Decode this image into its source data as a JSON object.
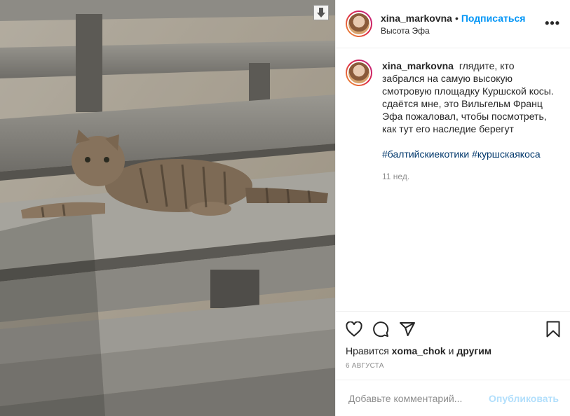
{
  "post": {
    "header": {
      "username": "xina_markovna",
      "separator": "•",
      "follow_label": "Подписаться",
      "location": "Высота Эфа",
      "more_label": "•••"
    },
    "caption": {
      "username": "xina_markovna",
      "text": "глядите, кто забрался на самую высокую смотровую площадку Куршской косы. сдаётся мне, это Вильгельм Франц Эфа пожаловал, чтобы посмотреть, как тут его наследие берегут",
      "hashtags": [
        "#балтийскиекотики",
        "#куршскаякоса"
      ],
      "age": "11 нед."
    },
    "likes": {
      "prefix": "Нравится",
      "user": "xoma_chok",
      "joiner": "и",
      "others": "другим"
    },
    "date": "6 АВГУСТА",
    "comment_box": {
      "placeholder": "Добавьте комментарий...",
      "publish_label": "Опубликовать"
    },
    "icons": {
      "download": "download-arrow-icon",
      "like": "heart-icon",
      "comment": "comment-bubble-icon",
      "share": "paper-plane-icon",
      "save": "bookmark-icon",
      "more": "ellipsis-icon"
    },
    "colors": {
      "link": "#0095f6",
      "hashtag": "#00376b",
      "muted": "#8e8e8e",
      "publish_disabled": "#b2dffc"
    }
  }
}
